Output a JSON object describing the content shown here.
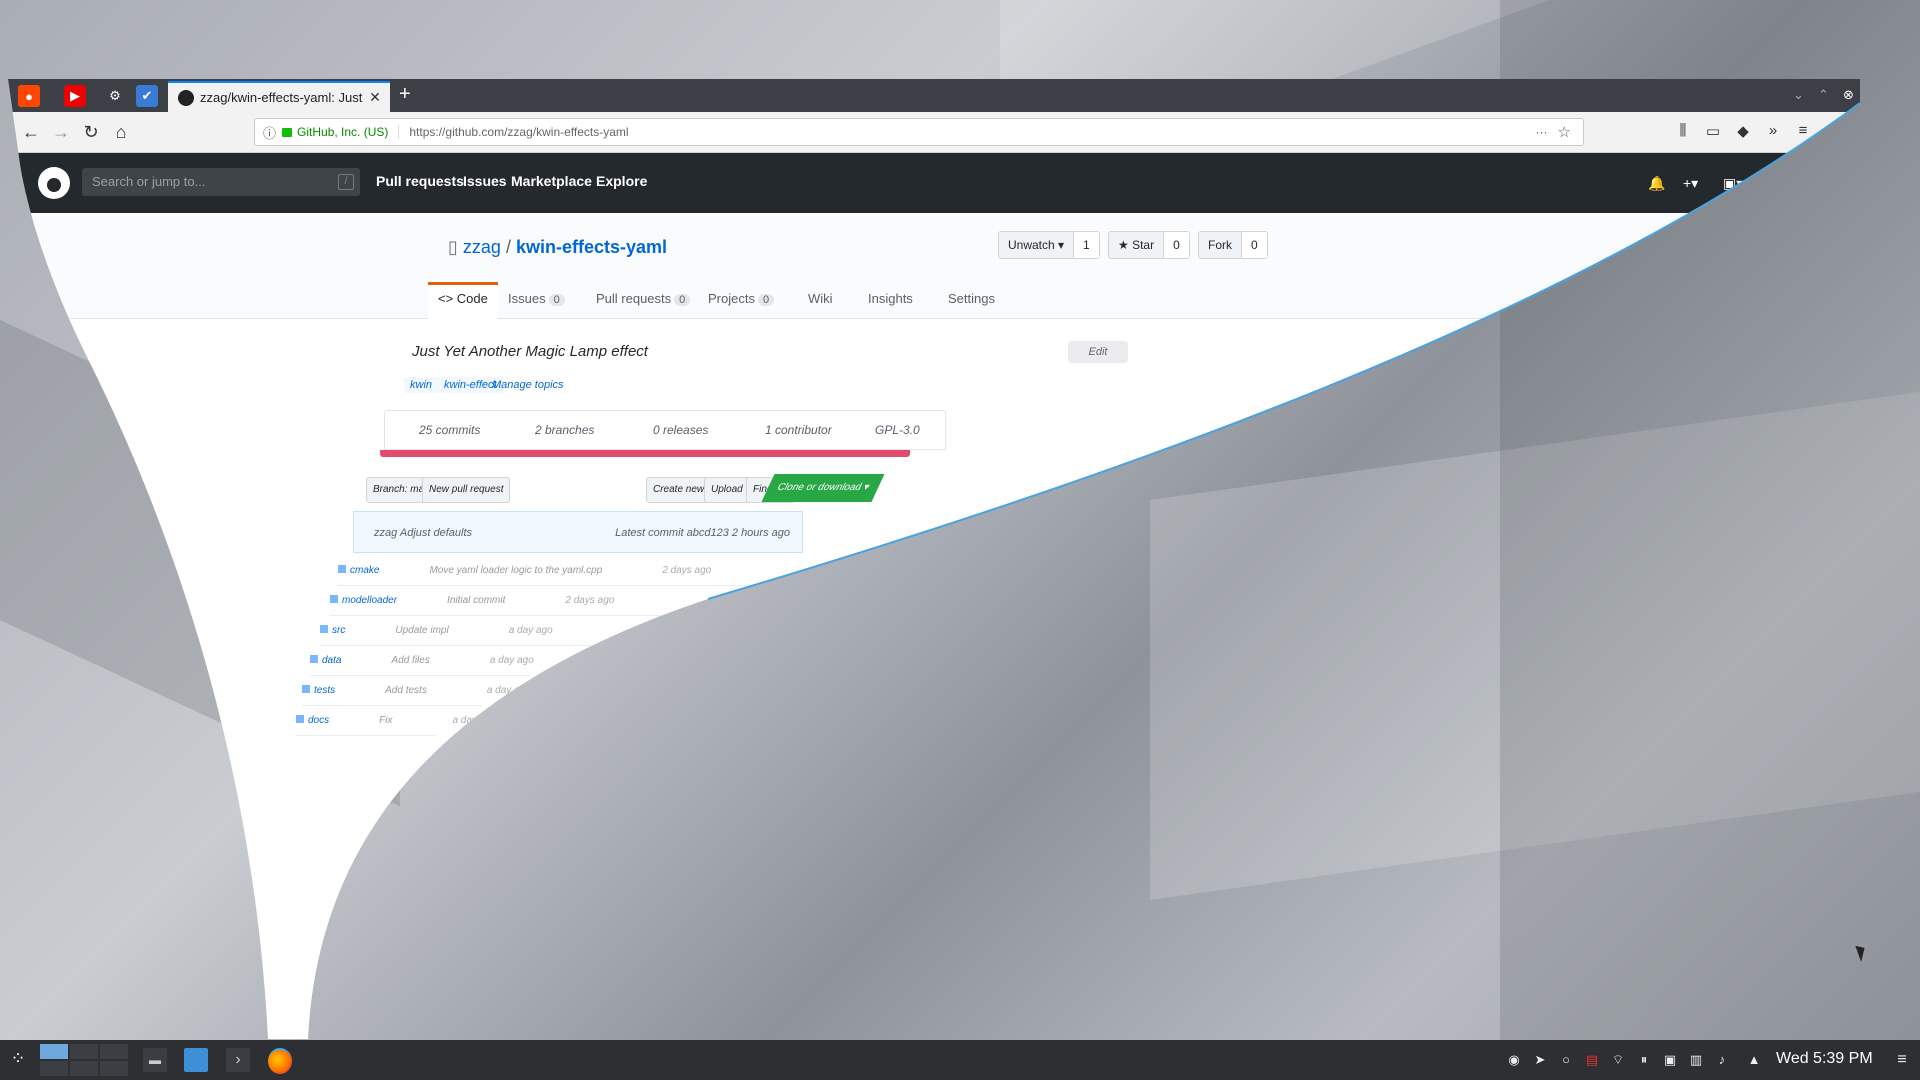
{
  "browser": {
    "active_tab_title": "zzag/kwin-effects-yaml: Just",
    "new_tab_label": "+",
    "close_tab_label": "✕",
    "url_info_label": "ⓘ",
    "site_identity": "GitHub, Inc. (US)",
    "url": "https://github.com/zzag/kwin-effects-yaml",
    "more_label": "···",
    "bookmark_label": "☆"
  },
  "github": {
    "search_placeholder": "Search or jump to...",
    "search_key": "/",
    "nav": [
      "Pull requests",
      "Issues",
      "Marketplace",
      "Explore"
    ],
    "owner": "zzag",
    "separator": "/",
    "repo": "kwin-effects-yaml",
    "unwatch_label": "Unwatch ▾",
    "watch_count": "1",
    "star_label": "★ Star",
    "star_count": "0",
    "fork_label": "Fork",
    "fork_count": "0",
    "tabs": {
      "code": "<> Code",
      "issues": "Issues",
      "issues_count": "0",
      "pulls": "Pull requests",
      "pulls_count": "0",
      "projects": "Projects",
      "projects_count": "0",
      "wiki": "Wiki",
      "insights": "Insights",
      "settings": "Settings"
    },
    "description": "Just Yet Another Magic Lamp effect",
    "edit_label": "Edit",
    "topics": [
      "kwin",
      "kwin-effect"
    ],
    "manage_topics": "Manage topics",
    "summary": {
      "commits": "25 commits",
      "branches": "2 branches",
      "releases": "0 releases",
      "contributors": "1 contributor",
      "license": "GPL-3.0"
    },
    "branch_label": "Branch: master ▾",
    "new_pr_label": "New pull request",
    "create_file_label": "Create new file",
    "upload_label": "Upload files",
    "find_file_label": "Find file",
    "clone_label": "Clone or download ▾",
    "latest_commit": "zzag Adjust defaults",
    "latest_commit_meta": "Latest commit abcd123 2 hours ago",
    "files": [
      {
        "name": "cmake",
        "msg": "Move yaml loader logic to the yaml.cpp",
        "ago": "2 days ago"
      },
      {
        "name": "modelloader",
        "msg": "Initial commit",
        "ago": "2 days ago"
      },
      {
        "name": "src",
        "msg": "Update impl",
        "ago": "a day ago"
      },
      {
        "name": "data",
        "msg": "Add files",
        "ago": "a day ago"
      },
      {
        "name": "tests",
        "msg": "Add tests",
        "ago": "a day ago"
      },
      {
        "name": "docs",
        "msg": "Fix",
        "ago": "a day ago"
      }
    ]
  },
  "taskbar": {
    "clock": "Wed 5:39 PM",
    "menu_label": "≡"
  },
  "colors": {
    "github_header": "#24292e",
    "tab_accent": "#0a84ff",
    "lang_bar": "#e34c6f",
    "clone_green": "#28a745",
    "taskbar": "#2d2f33"
  }
}
